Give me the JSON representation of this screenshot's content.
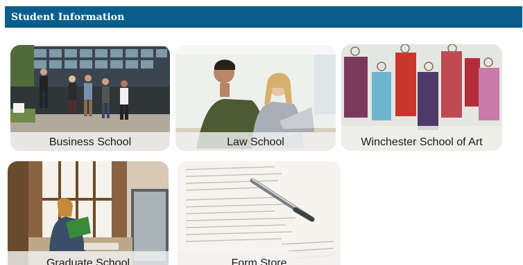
{
  "header": {
    "title": "Student Information"
  },
  "tiles": [
    {
      "label": "Business School"
    },
    {
      "label": "Law School"
    },
    {
      "label": "Winchester School of Art"
    },
    {
      "label": "Graduate School"
    },
    {
      "label": "Form Store"
    }
  ],
  "colors": {
    "header_bg": "#0a5e8c",
    "header_text": "#ffffff",
    "label_bg": "#f2f2f2"
  }
}
